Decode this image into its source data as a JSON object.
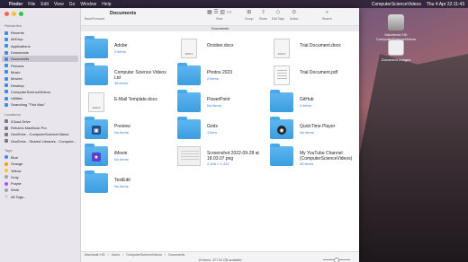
{
  "menubar": {
    "items": [
      "Finder",
      "File",
      "Edit",
      "View",
      "Go",
      "Window",
      "Help"
    ],
    "right_app": "ComputerScienceVideos",
    "clock": "Thu 4 Apr  22:11:43"
  },
  "desktop": {
    "drive_label": "Macintosh HD\nComputerScienceVideos",
    "doc_label": "Document Images"
  },
  "sidebar": {
    "favorites_heading": "Favourites",
    "favorites": [
      "Recents",
      "AirDrop",
      "Applications",
      "Downloads",
      "Documents",
      "Pictures",
      "Music",
      "Movies",
      "Desktop",
      "ComputerScienceVideos",
      "Utilities",
      "Searching \"This Mac\""
    ],
    "locations_heading": "Locations",
    "locations": [
      "iCloud Drive",
      "Rehan's MacBook Pro",
      "OneDrive - ComputerScienceVideos",
      "OneDrive - Shared Libraries - Compute..."
    ],
    "tags_heading": "Tags",
    "tags": [
      {
        "label": "Blue",
        "color": "#3b82f6"
      },
      {
        "label": "Orange",
        "color": "#f59e0b"
      },
      {
        "label": "Yellow",
        "color": "#facc15"
      },
      {
        "label": "Gray",
        "color": "#9ca3af"
      },
      {
        "label": "Purple",
        "color": "#a855f7"
      },
      {
        "label": "Work",
        "color": "#9ca3af"
      },
      {
        "label": "All Tags...",
        "color": "#d1d5db"
      }
    ]
  },
  "toolbar": {
    "title": "Documents",
    "back_forward": "Back/Forward",
    "view": "View",
    "group": "Group",
    "share": "Share",
    "edit_tags": "Edit Tags",
    "action": "Action",
    "search": "Search",
    "tab_label": "Documents"
  },
  "files": [
    {
      "name": "Adobe",
      "meta": "2 items",
      "kind": "folder"
    },
    {
      "name": "October.docx",
      "meta": "",
      "kind": "docx"
    },
    {
      "name": "Trial Document.docx",
      "meta": "",
      "kind": "docx"
    },
    {
      "name": "Computer Science Videos Ltd",
      "meta": "38 items",
      "kind": "folder"
    },
    {
      "name": "Photos 2023",
      "meta": "2 items",
      "kind": "folder"
    },
    {
      "name": "Trial Document.pdf",
      "meta": "",
      "kind": "pdf"
    },
    {
      "name": "E-Mail Template.docx",
      "meta": "",
      "kind": "docx"
    },
    {
      "name": "PowerPoint",
      "meta": "No items",
      "kind": "folder"
    },
    {
      "name": "GitHub",
      "meta": "2 items",
      "kind": "folder"
    },
    {
      "name": "Preview",
      "meta": "No items",
      "kind": "preview"
    },
    {
      "name": "Grids",
      "meta": "1 item",
      "kind": "folder"
    },
    {
      "name": "QuickTime Player",
      "meta": "No items",
      "kind": "quicktime"
    },
    {
      "name": "iMovie",
      "meta": "No items",
      "kind": "imovie"
    },
    {
      "name": "Screenshot 2022-09-28 at 18.03.07.png",
      "meta": "2,406 × 1,442",
      "kind": "shot"
    },
    {
      "name": "My YouTube Channel (ComputerScienceVideos)",
      "meta": "38 items",
      "kind": "folder"
    },
    {
      "name": "TextEdit",
      "meta": "No items",
      "kind": "folder"
    }
  ],
  "docx_label": "DOCX",
  "statusbar": {
    "crumbs": [
      "Macintosh HD",
      "Users",
      "ComputerScienceVideos",
      "Documents"
    ],
    "text": "16 items, 377.91 GB available"
  }
}
